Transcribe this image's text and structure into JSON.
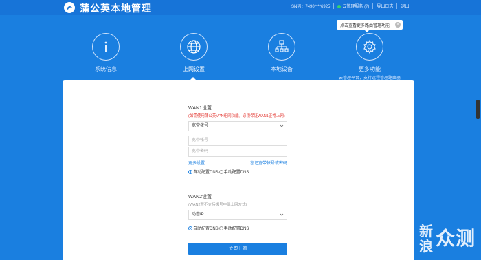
{
  "header": {
    "brand": "蒲公英本地管理",
    "sn_label": "SN码：",
    "sn_value": "7490****6925",
    "cloud_service": "云管理服务",
    "help": "(?)",
    "log": "导出日志",
    "logout": "退出"
  },
  "tooltip": {
    "text": "点击查看更多路由管理功能",
    "close": "×"
  },
  "nav": {
    "items": [
      {
        "label": "系统信息",
        "icon": "info-icon"
      },
      {
        "label": "上网设置",
        "icon": "globe-icon"
      },
      {
        "label": "本地设备",
        "icon": "network-icon"
      },
      {
        "label": "更多功能",
        "icon": "gear-icon",
        "sub": "云管理平台，支持远程管理路由器"
      }
    ],
    "active_index": 1
  },
  "wan1": {
    "title": "WAN1设置",
    "note": "(如需使用蒲公英VPN组网功能，必须保证WAN1正常上网)",
    "mode": "宽带拨号",
    "account_placeholder": "宽带帐号",
    "password_placeholder": "宽带密码",
    "more_settings": "更多设置",
    "forgot": "忘记宽带帐号或密码",
    "dns_auto": "自动配置DNS",
    "dns_manual": "手动配置DNS",
    "dns_selected": "auto"
  },
  "wan2": {
    "title": "WAN2设置",
    "note": "(WAN2暂不支持拨号中继上网方式)",
    "mode": "动态IP",
    "dns_auto": "自动配置DNS",
    "dns_manual": "手动配置DNS",
    "dns_selected": "auto"
  },
  "submit_label": "立即上网",
  "watermark": {
    "line1": "新",
    "line2": "浪",
    "line3": "众测"
  },
  "colors": {
    "primary": "#1a7fe0",
    "topbar": "#1774d8",
    "alert": "#e2322c",
    "online": "#35d36a"
  }
}
